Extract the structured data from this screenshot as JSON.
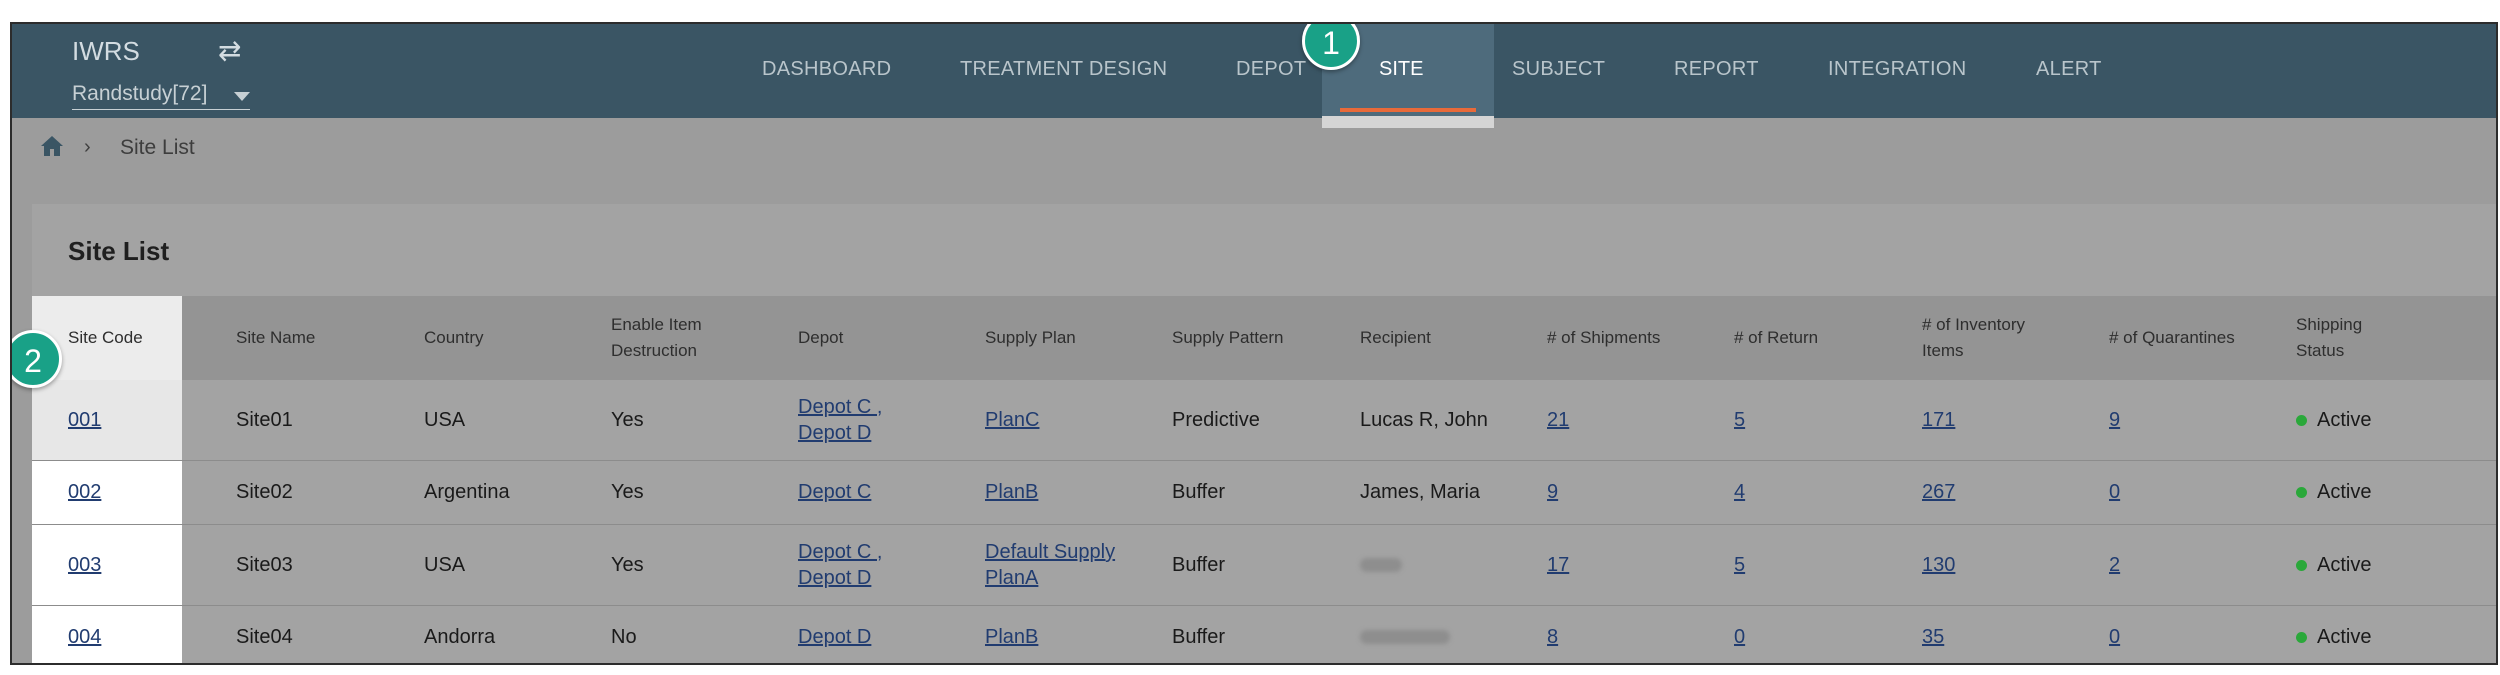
{
  "app": {
    "brand": "IWRS",
    "study": "Randstudy[72]"
  },
  "nav": {
    "tabs": [
      "DASHBOARD",
      "TREATMENT DESIGN",
      "DEPOT",
      "SITE",
      "SUBJECT",
      "REPORT",
      "INTEGRATION",
      "ALERT"
    ],
    "active": "SITE"
  },
  "callouts": [
    "1",
    "2"
  ],
  "breadcrumb": {
    "label": "Site List"
  },
  "page": {
    "title": "Site List"
  },
  "table": {
    "headers": {
      "code": "Site Code",
      "name": "Site Name",
      "country": "Country",
      "destruction": "Enable Item Destruction",
      "depot": "Depot",
      "plan": "Supply Plan",
      "pattern": "Supply Pattern",
      "recipient": "Recipient",
      "shipments": "# of Shipments",
      "returns": "# of Return",
      "inventory": "# of Inventory Items",
      "quarantines": "# of Quarantines",
      "status": "Shipping Status"
    },
    "rows": [
      {
        "code": "001",
        "name": "Site01",
        "country": "USA",
        "destruction": "Yes",
        "depot1": "Depot C ,",
        "depot2": "Depot D",
        "plan1": "PlanC",
        "plan2": "",
        "pattern": "Predictive",
        "recipient": "Lucas R, John",
        "shipments": "21",
        "returns": "5",
        "inventory": "171",
        "quarantines": "9",
        "status": "Active"
      },
      {
        "code": "002",
        "name": "Site02",
        "country": "Argentina",
        "destruction": "Yes",
        "depot1": "Depot C",
        "depot2": "",
        "plan1": "PlanB",
        "plan2": "",
        "pattern": "Buffer",
        "recipient": "James, Maria",
        "shipments": "9",
        "returns": "4",
        "inventory": "267",
        "quarantines": "0",
        "status": "Active"
      },
      {
        "code": "003",
        "name": "Site03",
        "country": "USA",
        "destruction": "Yes",
        "depot1": "Depot C ,",
        "depot2": "Depot D",
        "plan1": "Default Supply",
        "plan2": "PlanA",
        "pattern": "Buffer",
        "recipient": "",
        "shipments": "17",
        "returns": "5",
        "inventory": "130",
        "quarantines": "2",
        "status": "Active"
      },
      {
        "code": "004",
        "name": "Site04",
        "country": "Andorra",
        "destruction": "No",
        "depot1": "Depot D",
        "depot2": "",
        "plan1": "PlanB",
        "plan2": "",
        "pattern": "Buffer",
        "recipient": "",
        "shipments": "8",
        "returns": "0",
        "inventory": "35",
        "quarantines": "0",
        "status": "Active"
      }
    ]
  },
  "colors": {
    "nav_bg": "#3a5564",
    "accent": "#19a187",
    "active_underline": "#e86a3a",
    "status_green": "#2aa83a",
    "link": "#213c70"
  }
}
